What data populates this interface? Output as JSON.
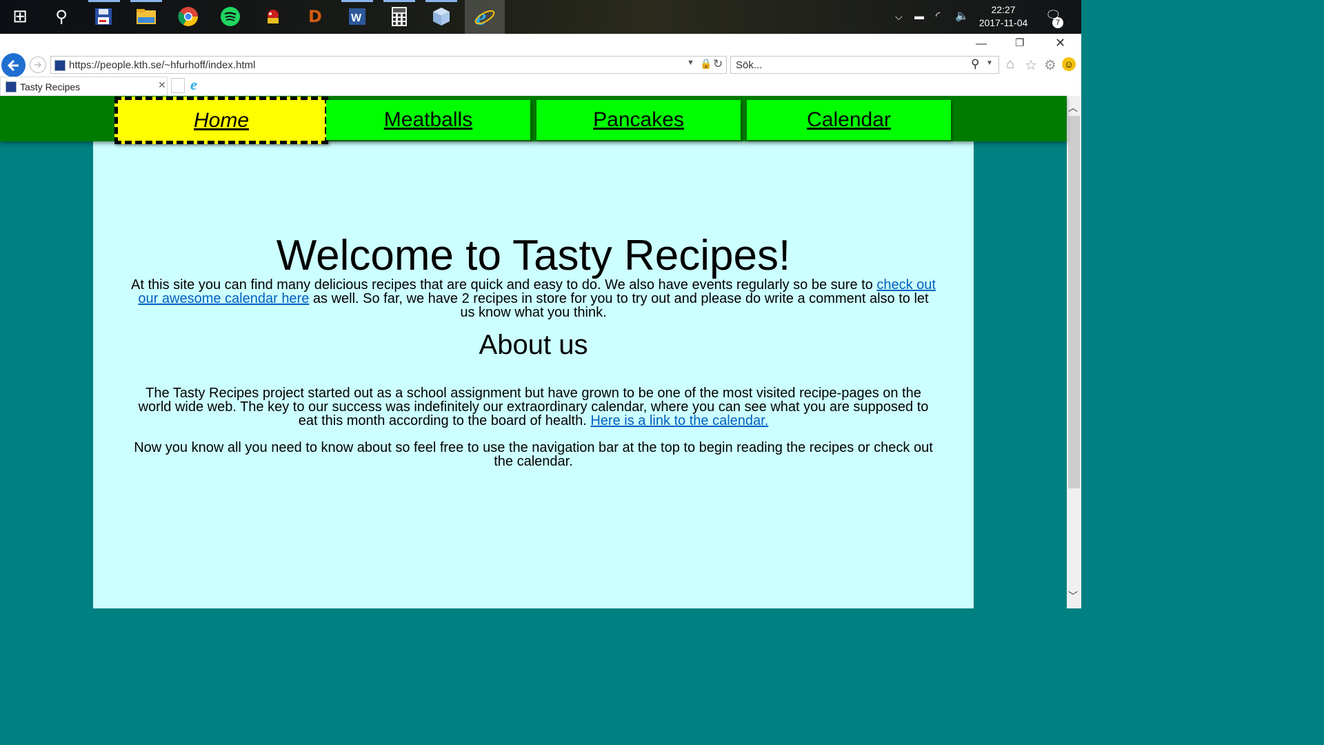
{
  "taskbar": {
    "icons": [
      {
        "name": "windows-start-icon",
        "glyph": "⊞"
      },
      {
        "name": "search-icon",
        "glyph": "⚲"
      },
      {
        "name": "floppy-app-icon",
        "glyph": "💾"
      },
      {
        "name": "file-explorer-icon",
        "glyph": "📁"
      },
      {
        "name": "chrome-icon",
        "glyph": "◉"
      },
      {
        "name": "spotify-icon",
        "glyph": "≋"
      },
      {
        "name": "game-app-icon",
        "glyph": "✦"
      },
      {
        "name": "diablo-icon",
        "glyph": "D"
      },
      {
        "name": "word-icon",
        "glyph": "W"
      },
      {
        "name": "calculator-icon",
        "glyph": "▦"
      },
      {
        "name": "cube-app-icon",
        "glyph": "◆"
      },
      {
        "name": "internet-explorer-icon",
        "glyph": "e"
      }
    ],
    "time": "22:27",
    "date": "2017-11-04",
    "notifications": "7"
  },
  "browser": {
    "url": "https://people.kth.se/~hfurhoff/index.html",
    "search_placeholder": "Sök...",
    "tab_title": "Tasty Recipes"
  },
  "nav": {
    "home": "Home",
    "meatballs": "Meatballs",
    "pancakes": "Pancakes",
    "calendar": "Calendar"
  },
  "page": {
    "title": "Welcome to Tasty Recipes!",
    "intro_before": "At this site you can find many delicious recipes that are quick and easy to do. We also have events regularly so be sure to ",
    "intro_link": "check out our awesome calendar here",
    "intro_after": " as well. So far, we have 2 recipes in store for you to try out and please do write a comment also to let us know what you think.",
    "about_heading": "About us",
    "about_before": "The Tasty Recipes project started out as a school assignment but have grown to be one of the most visited recipe-pages on the world wide web. The key to our success was indefinitely our extraordinary calendar, where you can see what you are supposed to eat this month according to the board of health. ",
    "about_link": "Here is a link to the calendar.",
    "closing": "Now you know all you need to know about so feel free to use the navigation bar at the top to begin reading the recipes or check out the calendar."
  },
  "colors": {
    "nav_bg": "#007b00",
    "nav_item": "#00ff00",
    "nav_active": "#ffff00",
    "page_bg": "#008080",
    "content_bg": "#ccffff"
  }
}
